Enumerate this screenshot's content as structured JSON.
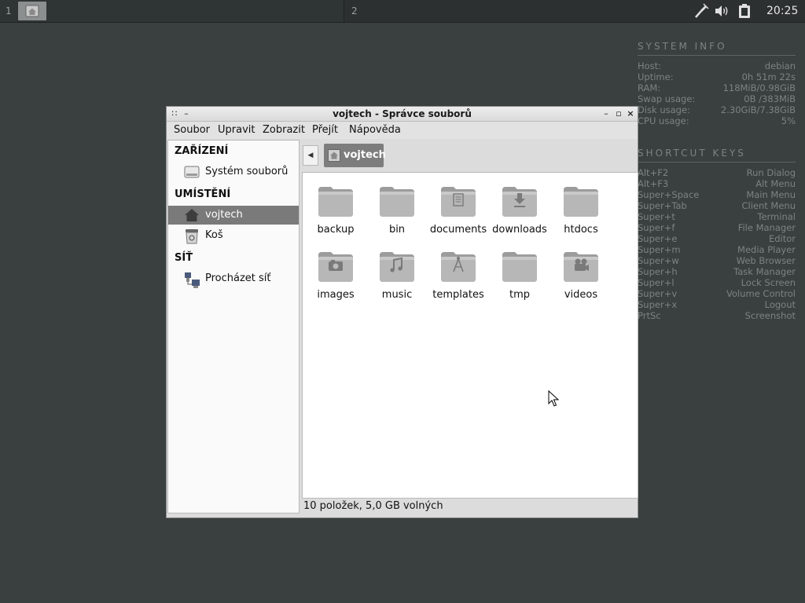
{
  "panel": {
    "workspace1": "1",
    "workspace2": "2",
    "tray_icons": [
      "network-icon",
      "volume-icon",
      "battery-icon"
    ],
    "clock": "20:25"
  },
  "conky": {
    "system_title": "SYSTEM INFO",
    "system": [
      {
        "label": "Host:",
        "value": "debian"
      },
      {
        "label": "Uptime:",
        "value": "0h 51m 22s"
      },
      {
        "label": "RAM:",
        "value": "118MiB/0.98GiB"
      },
      {
        "label": "Swap usage:",
        "value": "0B  /383MiB"
      },
      {
        "label": "Disk usage:",
        "value": "2.30GiB/7.38GiB"
      },
      {
        "label": "CPU usage:",
        "value": "5%"
      }
    ],
    "keys_title": "SHORTCUT KEYS",
    "keys": [
      {
        "key": "Alt+F2",
        "action": "Run Dialog"
      },
      {
        "key": "Alt+F3",
        "action": "Alt Menu"
      },
      {
        "key": "Super+Space",
        "action": "Main Menu"
      },
      {
        "key": "Super+Tab",
        "action": "Client Menu"
      },
      {
        "key": "Super+t",
        "action": "Terminal"
      },
      {
        "key": "Super+f",
        "action": "File Manager"
      },
      {
        "key": "Super+e",
        "action": "Editor"
      },
      {
        "key": "Super+m",
        "action": "Media Player"
      },
      {
        "key": "Super+w",
        "action": "Web Browser"
      },
      {
        "key": "Super+h",
        "action": "Task Manager"
      },
      {
        "key": "Super+l",
        "action": "Lock Screen"
      },
      {
        "key": "Super+v",
        "action": "Volume Control"
      },
      {
        "key": "Super+x",
        "action": "Logout"
      },
      {
        "key": "PrtSc",
        "action": "Screenshot"
      }
    ]
  },
  "window": {
    "title": "vojtech - Správce souborů",
    "menu": [
      "Soubor",
      "Upravit",
      "Zobrazit",
      "Přejít",
      "Nápověda"
    ],
    "sidebar": {
      "devices_head": "ZAŘÍZENÍ",
      "filesystem": "Systém souborů",
      "places_head": "UMÍSTĚNÍ",
      "home": "vojtech",
      "trash": "Koš",
      "network_head": "SÍŤ",
      "browse_network": "Procházet síť"
    },
    "crumb": "vojtech",
    "files": [
      {
        "name": "backup",
        "icon": "folder"
      },
      {
        "name": "bin",
        "icon": "folder"
      },
      {
        "name": "documents",
        "icon": "folder-documents"
      },
      {
        "name": "downloads",
        "icon": "folder-downloads"
      },
      {
        "name": "htdocs",
        "icon": "folder"
      },
      {
        "name": "images",
        "icon": "folder-pictures"
      },
      {
        "name": "music",
        "icon": "folder-music"
      },
      {
        "name": "templates",
        "icon": "folder-templates"
      },
      {
        "name": "tmp",
        "icon": "folder"
      },
      {
        "name": "videos",
        "icon": "folder-videos"
      }
    ],
    "status": "10 položek, 5,0 GB volných"
  }
}
